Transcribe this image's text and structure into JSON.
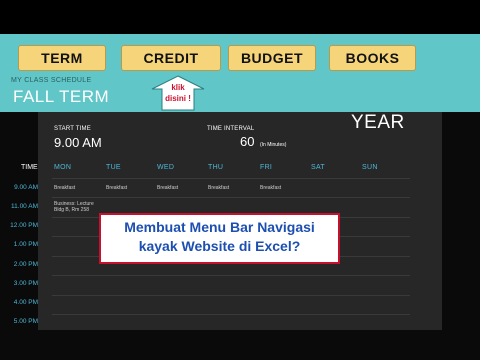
{
  "nav": {
    "term": "TERM",
    "credit": "CREDIT",
    "budget": "BUDGET",
    "books": "BOOKS"
  },
  "header": {
    "schedule_label": "MY CLASS SCHEDULE",
    "term_title": "FALL TERM"
  },
  "callout": {
    "line1": "klik",
    "line2": "disini !",
    "color": "#c8102e"
  },
  "settings": {
    "start_label": "START TIME",
    "start_value": "9.00 AM",
    "interval_label": "TIME INTERVAL",
    "interval_value": "60",
    "interval_unit": "(In Minutes)",
    "year_label": "YEAR"
  },
  "grid": {
    "time_header": "TIME",
    "days": [
      "MON",
      "TUE",
      "WED",
      "THU",
      "FRI",
      "SAT",
      "SUN"
    ],
    "times": [
      "9.00 AM",
      "11.00 AM",
      "12.00 PM",
      "1.00 PM",
      "2.00 PM",
      "3.00 PM",
      "4.00 PM",
      "5.00 PM"
    ],
    "row1_entries": [
      "Breakfast",
      "Breakfast",
      "Breakfast",
      "Breakfast",
      "Breakfast"
    ],
    "row2_note_line1": "Business: Lecture",
    "row2_note_line2": "Bldg B, Rm 258"
  },
  "banner": {
    "line1": "Membuat Menu Bar Navigasi",
    "line2": "kayak Website di Excel?",
    "text_color": "#1c4fb0",
    "border_color": "#c8102e"
  },
  "colors": {
    "teal": "#61c6c8",
    "button": "#f6d57a",
    "sheet": "#272727",
    "accent_blue": "#4fb8d8"
  }
}
